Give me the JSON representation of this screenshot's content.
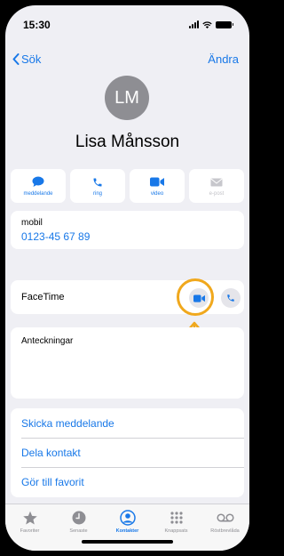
{
  "status_bar": {
    "time": "15:30"
  },
  "nav": {
    "back_label": "Sök",
    "edit_label": "Ändra"
  },
  "contact": {
    "initials": "LM",
    "name": "Lisa Månsson"
  },
  "actions": [
    {
      "label": "meddelande",
      "icon": "message-bubble-icon",
      "enabled": true
    },
    {
      "label": "ring",
      "icon": "phone-icon",
      "enabled": true
    },
    {
      "label": "video",
      "icon": "video-camera-icon",
      "enabled": true
    },
    {
      "label": "e-post",
      "icon": "envelope-icon",
      "enabled": false
    }
  ],
  "mobile": {
    "label": "mobil",
    "number": "0123-45 67 89"
  },
  "facetime": {
    "label": "FaceTime",
    "highlighted_button": "facetime-video"
  },
  "notes": {
    "label": "Anteckningar"
  },
  "links": [
    {
      "label": "Skicka meddelande"
    },
    {
      "label": "Dela kontakt"
    },
    {
      "label": "Gör till favorit"
    }
  ],
  "tab_bar": {
    "tabs": [
      {
        "label": "Favoriter",
        "icon": "star-icon",
        "active": false
      },
      {
        "label": "Senaste",
        "icon": "clock-icon",
        "active": false
      },
      {
        "label": "Kontakter",
        "icon": "person-circle-icon",
        "active": true
      },
      {
        "label": "Knappsats",
        "icon": "keypad-icon",
        "active": false
      },
      {
        "label": "Röstbrevlåda",
        "icon": "voicemail-icon",
        "active": false
      }
    ]
  },
  "colors": {
    "accent": "#1878e8",
    "highlight": "#f0a81d",
    "background": "#efeff4",
    "avatar": "#8e8e93"
  }
}
